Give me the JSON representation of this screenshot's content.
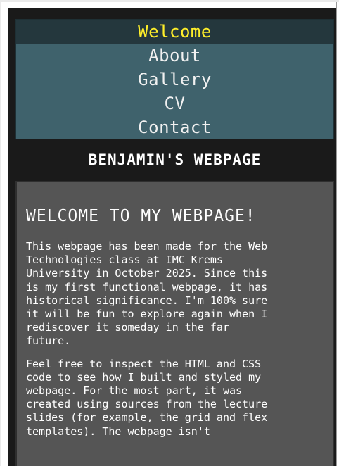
{
  "menu": {
    "items": [
      {
        "label": "Welcome"
      },
      {
        "label": "About"
      },
      {
        "label": "Gallery"
      },
      {
        "label": "CV"
      },
      {
        "label": "Contact"
      }
    ],
    "colors": {
      "background": "#3f626c",
      "active_background": "#24373d",
      "active_text": "#ffef2a",
      "text": "#f1f1f1"
    }
  },
  "header": {
    "site_title": "BENJAMIN'S WEBPAGE"
  },
  "main": {
    "heading": "WELCOME TO MY WEBPAGE!",
    "paragraphs": [
      "This webpage has been made for the Web\nTechnologies class at IMC Krems\nUniversity in October 2025. Since this\nis my first functional webpage, it has\nhistorical significance. I'm 100% sure\nit will be fun to explore again when I\nrediscover it someday in the far\nfuture.",
      "Feel free to inspect the HTML and CSS\ncode to see how I built and styled my\nwebpage. For the most part, it was\ncreated using sources from the lecture\nslides (for example, the grid and flex\ntemplates). The webpage isn't"
    ]
  }
}
